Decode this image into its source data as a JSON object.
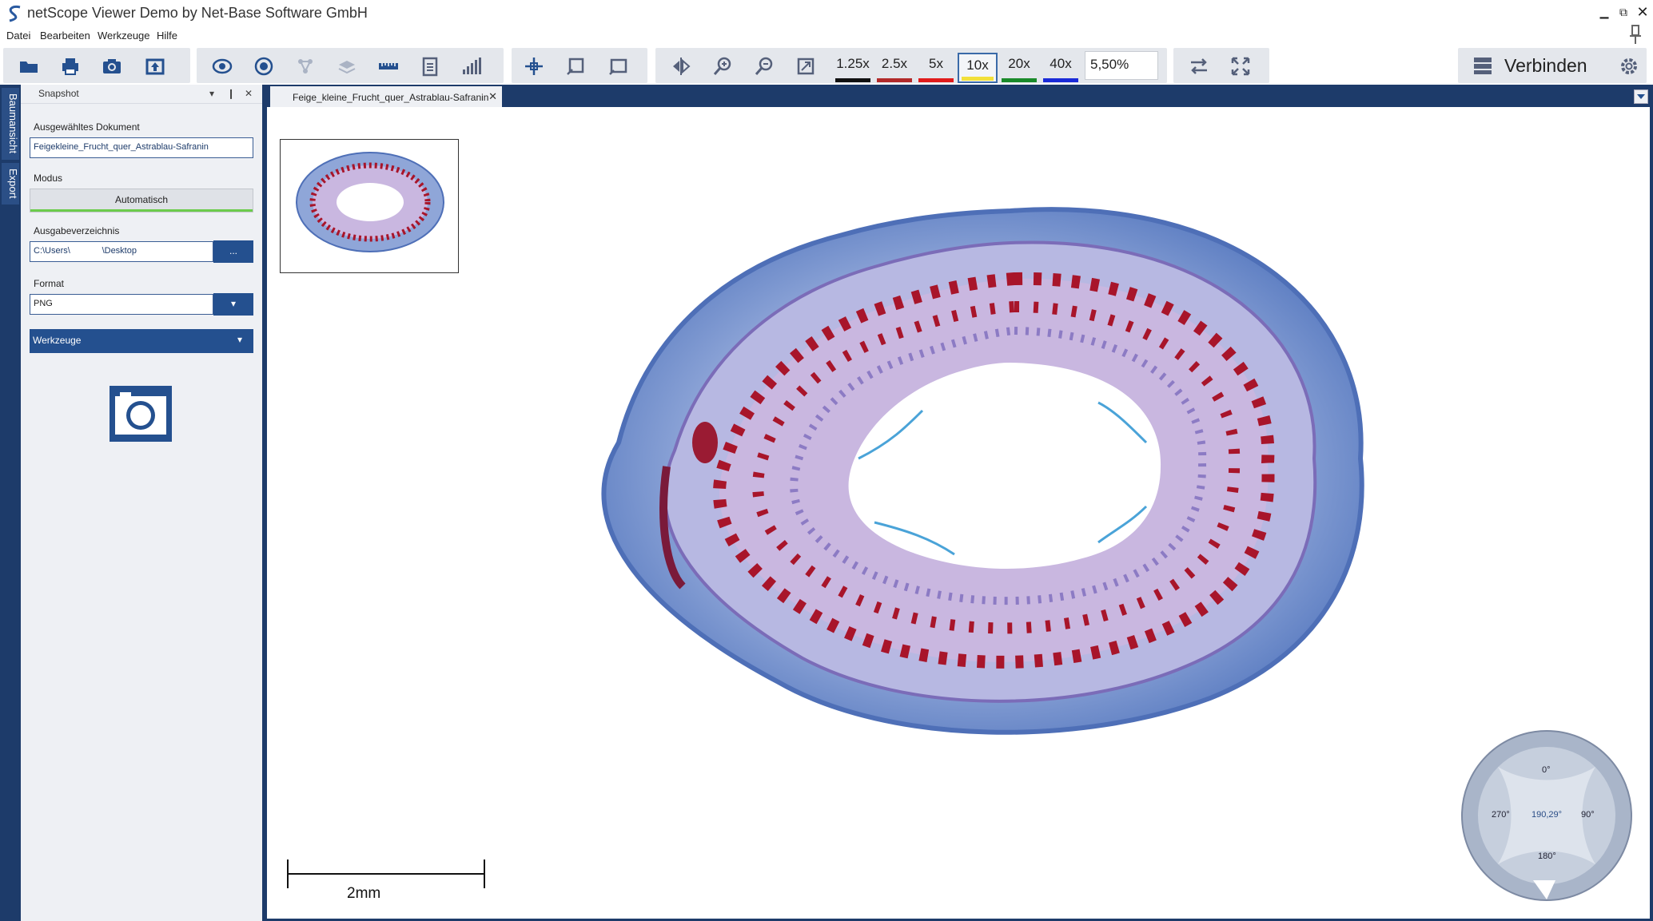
{
  "window": {
    "title": "netScope Viewer Demo by Net-Base Software GmbH",
    "controls": [
      "minimize-icon",
      "restore-icon",
      "close-icon"
    ]
  },
  "menu": {
    "items": [
      "Datei",
      "Bearbeiten",
      "Werkzeuge",
      "Hilfe"
    ]
  },
  "toolbar": {
    "icons": [
      "open-folder-icon",
      "print-icon",
      "camera-icon",
      "upload-icon",
      "eye-icon",
      "target-icon",
      "network-icon",
      "layers-icon",
      "ruler-icon",
      "clipboard-icon",
      "signal-icon",
      "crosshair-icon",
      "rect-select-icon",
      "rect-icon",
      "flip-icon",
      "zoom-in-icon",
      "zoom-out-icon",
      "fit-icon",
      "swap-icon",
      "fullscreen-icon",
      "settings-icon"
    ],
    "magnifications": [
      {
        "label": "1.25x",
        "color": "#111111"
      },
      {
        "label": "2.5x",
        "color": "#b22a2a"
      },
      {
        "label": "5x",
        "color": "#e01b1b"
      },
      {
        "label": "10x",
        "color": "#f2e03a"
      },
      {
        "label": "20x",
        "color": "#1a8a2a"
      },
      {
        "label": "40x",
        "color": "#1a2ad8"
      }
    ],
    "active_magnification": "10x",
    "zoom_value": "5,50%",
    "connect_label": "Verbinden"
  },
  "sidetabs": [
    "Baumansicht",
    "Export"
  ],
  "panel": {
    "title": "Snapshot",
    "selected_document_label": "Ausgewähltes Dokument",
    "selected_document_value": "Feigekleine_Frucht_quer_Astrablau-Safranin",
    "mode_label": "Modus",
    "mode_value": "Automatisch",
    "output_dir_label": "Ausgabeverzeichnis",
    "output_dir_value": "C:\\Users\\             \\Desktop",
    "browse_label": "...",
    "format_label": "Format",
    "format_value": "PNG",
    "tools_label": "Werkzeuge"
  },
  "document": {
    "tab_label": "Feige_kleine_Frucht_quer_Astrablau-Safranin",
    "scale_label": "2mm"
  },
  "rotation": {
    "top": "0°",
    "right": "90°",
    "bottom": "180°",
    "left": "270°",
    "current": "190,29°"
  },
  "colors": {
    "chrome": "#1d3b6a",
    "accent": "#24508f",
    "stain_blue": "#6f8fc8",
    "stain_red": "#a8152a",
    "stain_violet": "#b9a3d6"
  }
}
